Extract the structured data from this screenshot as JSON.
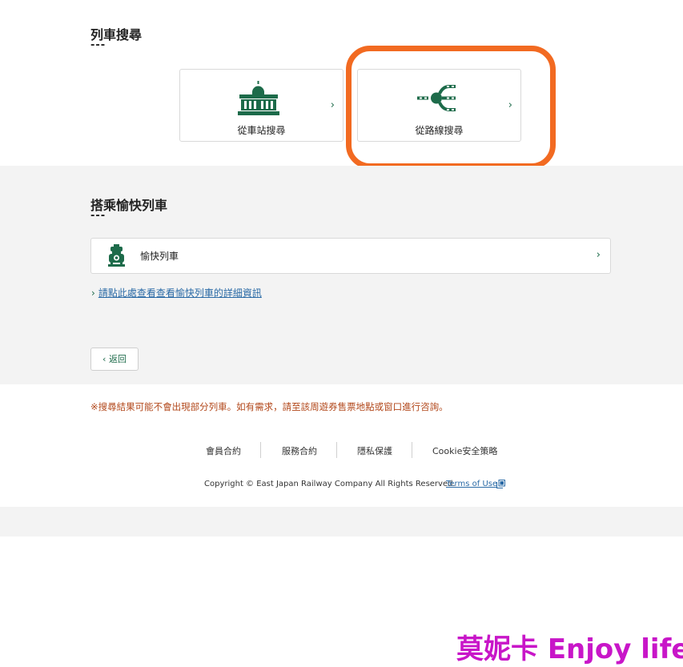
{
  "train_search": {
    "title": "列車搜尋",
    "dashes": "---",
    "by_station_label": "從車站搜尋",
    "by_route_label": "從路線搜尋",
    "chevron": "›"
  },
  "joyful_trains": {
    "title": "搭乘愉快列車",
    "dashes": "---",
    "item_label": "愉快列車",
    "chevron": "›",
    "info_link_arrow": "›",
    "info_link_text": "請點此處查看查看愉快列車的詳細資訊"
  },
  "back_button": {
    "label": "‹ 返回"
  },
  "notice": "※搜尋結果可能不會出現部分列車。如有需求，請至該周遊券售票地點或窗口進行咨詢。",
  "footer": {
    "links": [
      "會員合約",
      "服務合約",
      "隱私保護",
      "Cookie安全策略"
    ],
    "copyright": "Copyright © East Japan Railway Company All Rights Reserved.",
    "terms": "Terms of Use"
  },
  "watermark": "莫妮卡 Enjoy life",
  "colors": {
    "brand_green": "#1d6b4a",
    "highlight_orange": "#f26a21",
    "notice": "#b2471a",
    "link_blue": "#2a6aa6",
    "watermark": "#c816c8"
  },
  "icons": [
    "station-building-icon",
    "route-branch-icon",
    "train-front-icon",
    "external-link-icon"
  ]
}
